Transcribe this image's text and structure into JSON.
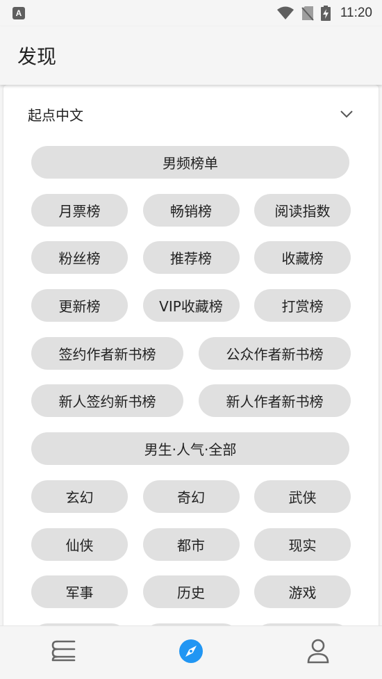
{
  "status_bar": {
    "notification_icon": "app-a-icon",
    "notification_letter": "A",
    "icons": [
      "wifi-icon",
      "no-sim-icon",
      "battery-charging-icon"
    ],
    "time": "11:20"
  },
  "header": {
    "title": "发现"
  },
  "section": {
    "title": "起点中文",
    "expand_icon": "chevron-down-icon",
    "rows": [
      [
        "男频榜单"
      ],
      [
        "月票榜",
        "畅销榜",
        "阅读指数"
      ],
      [
        "粉丝榜",
        "推荐榜",
        "收藏榜"
      ],
      [
        "更新榜",
        "VIP收藏榜",
        "打赏榜"
      ],
      [
        "签约作者新书榜",
        "公众作者新书榜"
      ],
      [
        "新人签约新书榜",
        "新人作者新书榜"
      ],
      [
        "男生·人气·全部"
      ],
      [
        "玄幻",
        "奇幻",
        "武侠"
      ],
      [
        "仙侠",
        "都市",
        "现实"
      ],
      [
        "军事",
        "历史",
        "游戏"
      ],
      [
        "",
        "",
        ""
      ]
    ]
  },
  "bottom_nav": {
    "items": [
      {
        "name": "bookshelf",
        "icon": "bookshelf-icon",
        "active": false
      },
      {
        "name": "discover",
        "icon": "compass-icon",
        "active": true
      },
      {
        "name": "profile",
        "icon": "person-icon",
        "active": false
      }
    ],
    "active_color": "#2196f3",
    "inactive_color": "#666666"
  }
}
